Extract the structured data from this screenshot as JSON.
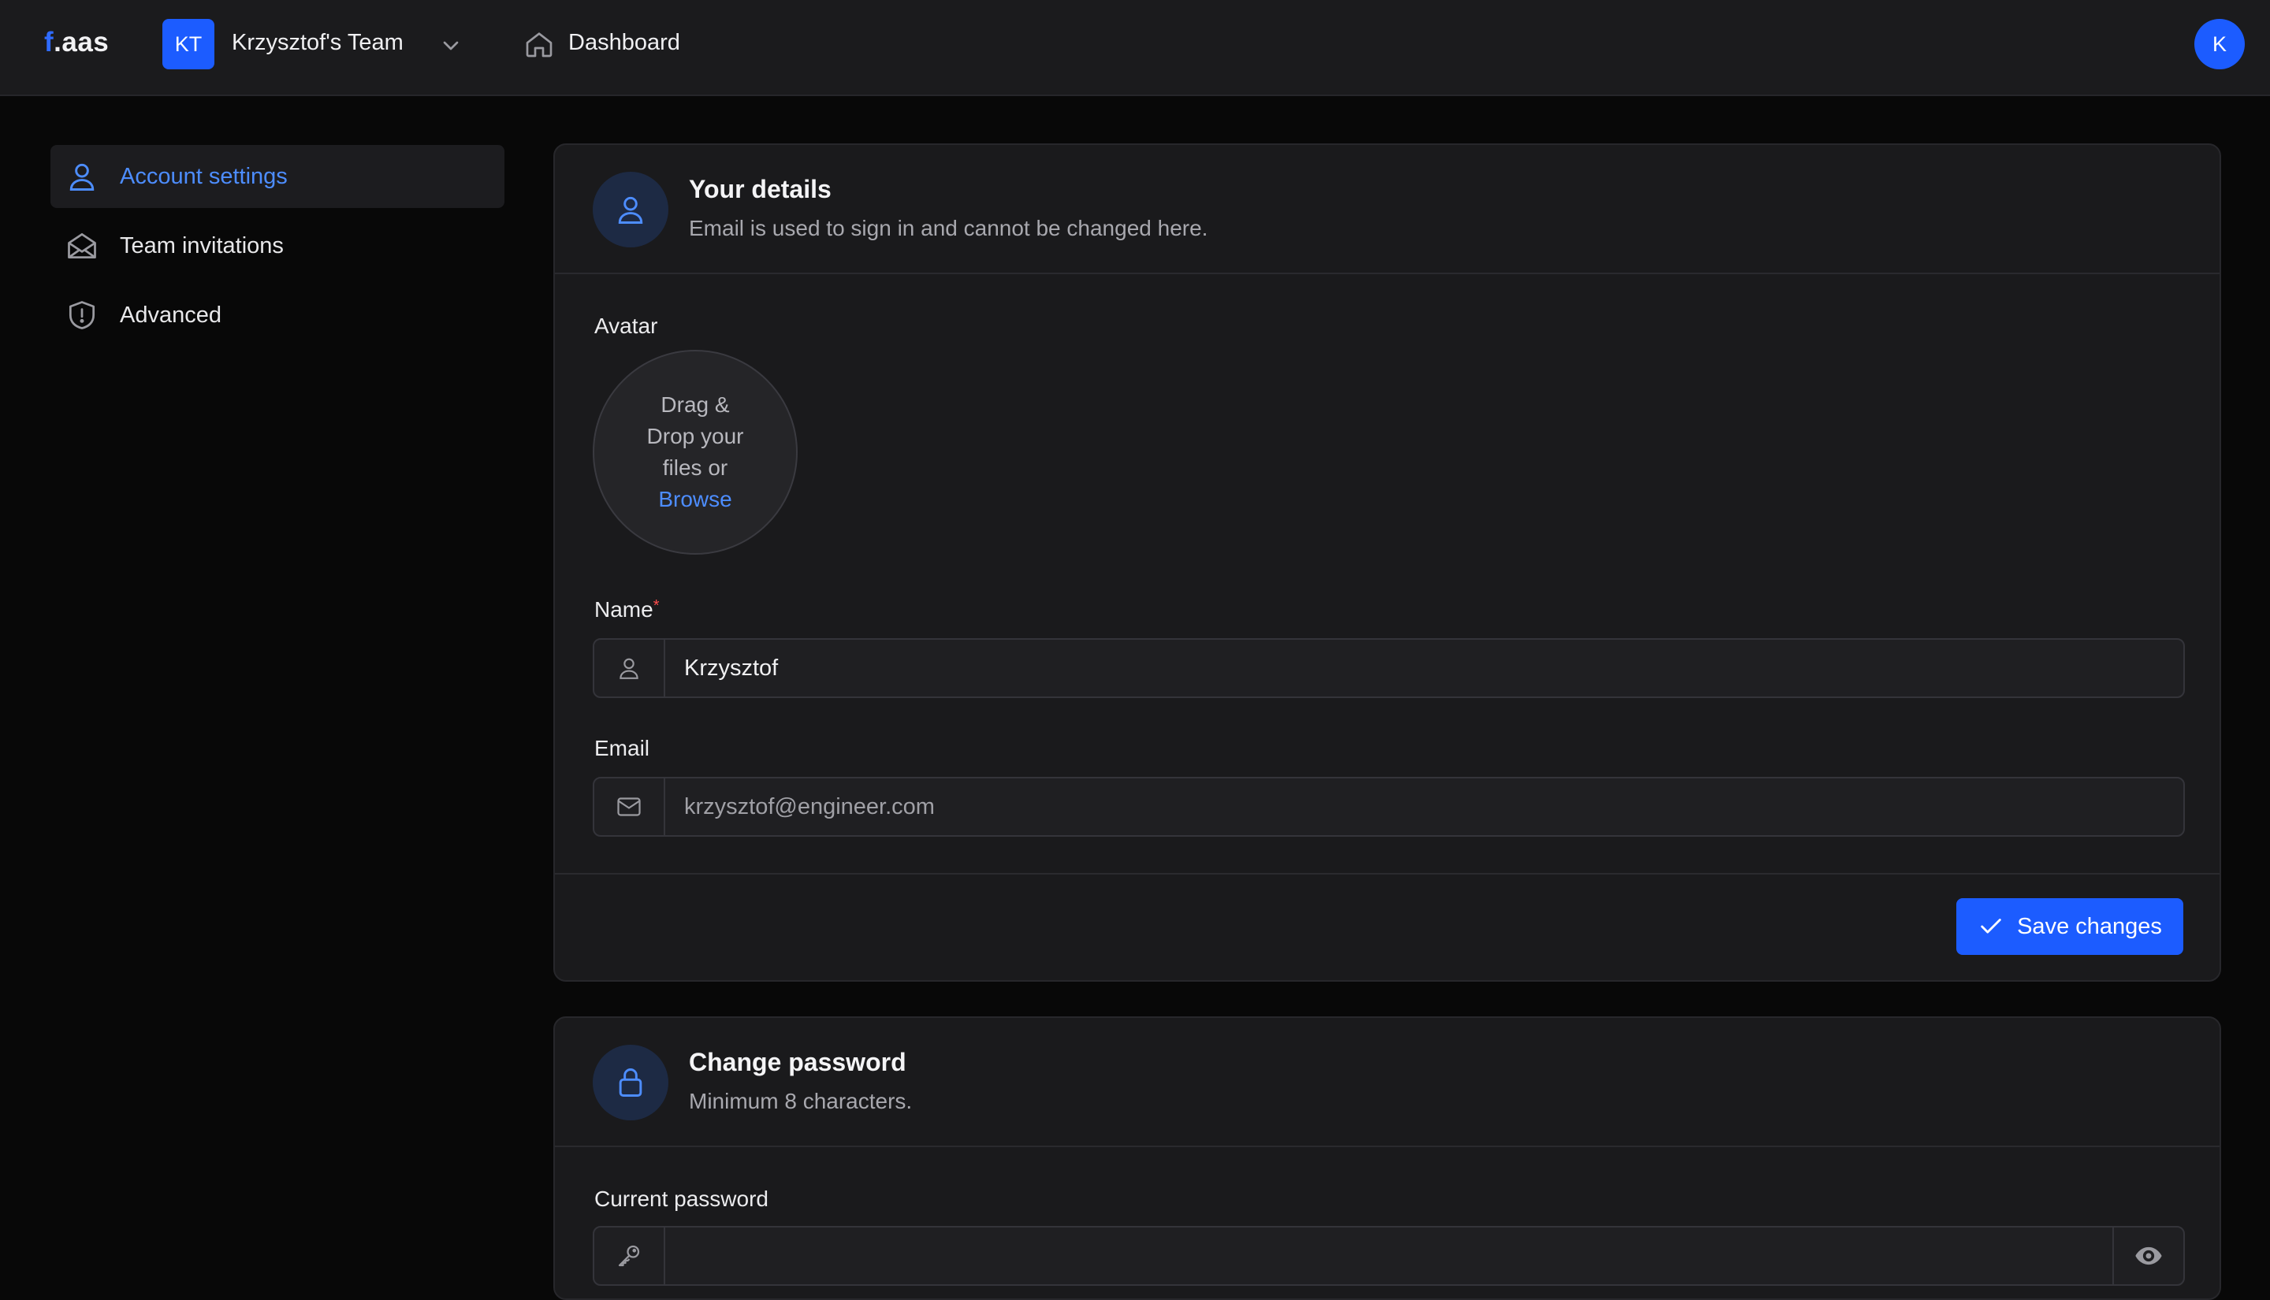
{
  "topbar": {
    "logo_prefix": "f",
    "logo_suffix": ".aas",
    "team_initials": "KT",
    "team_name": "Krzysztof's Team",
    "dashboard_label": "Dashboard",
    "user_initial": "K"
  },
  "sidebar": {
    "items": [
      {
        "label": "Account settings",
        "icon": "user-icon",
        "active": true
      },
      {
        "label": "Team invitations",
        "icon": "envelope-open-icon",
        "active": false
      },
      {
        "label": "Advanced",
        "icon": "shield-alert-icon",
        "active": false
      }
    ]
  },
  "details_card": {
    "title": "Your details",
    "subtitle": "Email is used to sign in and cannot be changed here.",
    "avatar_label": "Avatar",
    "dropzone": {
      "line1": "Drag &",
      "line2": "Drop your",
      "line3": "files or",
      "browse": "Browse"
    },
    "name_label": "Name",
    "name_required_mark": "*",
    "name_value": "Krzysztof",
    "email_label": "Email",
    "email_value": "krzysztof@engineer.com",
    "save_label": "Save changes"
  },
  "password_card": {
    "title": "Change password",
    "subtitle": "Minimum 8 characters.",
    "current_label": "Current password",
    "current_value": ""
  },
  "colors": {
    "accent": "#1c5cff",
    "link": "#4d8dff",
    "background": "#080808",
    "surface": "#1a1a1c"
  }
}
